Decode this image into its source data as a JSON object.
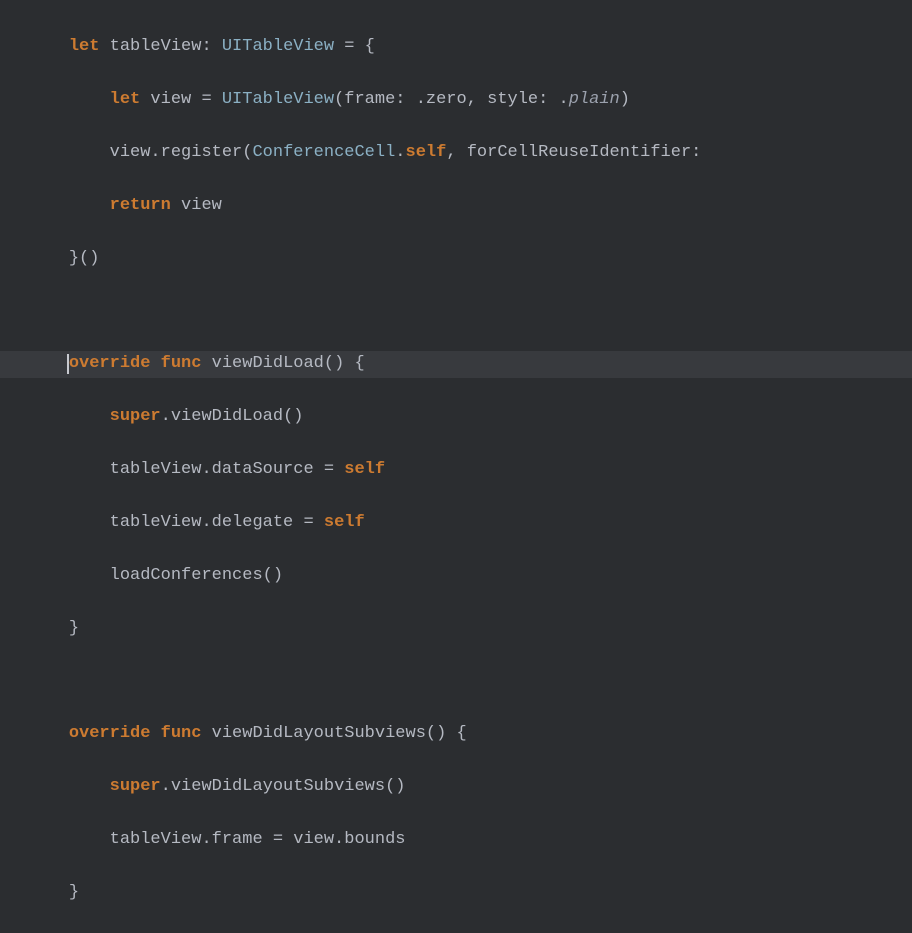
{
  "code": {
    "l1_let": "let",
    "l1_name": " tableView",
    "l1_colon": ": ",
    "l1_type": "UITableView",
    "l1_eq": " = {",
    "l2_let": "let",
    "l2_name": " view = ",
    "l2_type": "UITableView",
    "l2_open": "(",
    "l2_p1": "frame",
    "l2_c1": ": .",
    "l2_v1": "zero",
    "l2_comma": ", ",
    "l2_p2": "style",
    "l2_c2": ": .",
    "l2_v2": "plain",
    "l2_close": ")",
    "l3_pre": "view.",
    "l3_fn": "register",
    "l3_open": "(",
    "l3_type": "ConferenceCell",
    "l3_dot": ".",
    "l3_self": "self",
    "l3_comma": ", ",
    "l3_p1": "forCellReuseIdentifier",
    "l3_colon": ":",
    "l4_ret": "return",
    "l4_v": " view",
    "l5": "}()",
    "l6_ovr": "override",
    "l6_func": "func",
    "l6_name": " viewDidLoad",
    "l6_sig": "() {",
    "l7_super": "super",
    "l7_dot": ".",
    "l7_fn": "viewDidLoad",
    "l7_p": "()",
    "l8_pre": "tableView.dataSource = ",
    "l8_self": "self",
    "l9_pre": "tableView.delegate = ",
    "l9_self": "self",
    "l10_fn": "loadConferences",
    "l10_p": "()",
    "l11": "}",
    "l12_ovr": "override",
    "l12_func": "func",
    "l12_name": " viewDidLayoutSubviews",
    "l12_sig": "() {",
    "l13_super": "super",
    "l13_dot": ".",
    "l13_fn": "viewDidLayoutSubviews",
    "l13_p": "()",
    "l14": "tableView.frame = view.bounds",
    "l15": "}",
    "sp4": "    ",
    "sp8": "        ",
    "spc": " "
  }
}
